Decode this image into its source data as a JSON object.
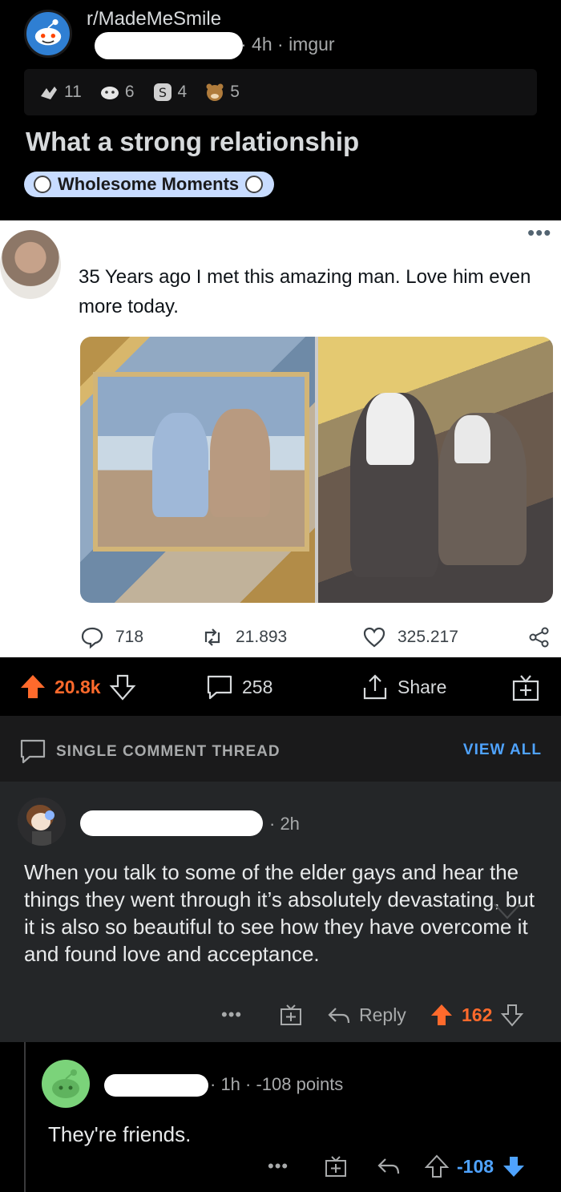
{
  "post": {
    "subreddit": "r/MadeMeSmile",
    "meta": "· 4h · imgur",
    "awards": [
      {
        "icon": "hug-award-icon",
        "count": "11"
      },
      {
        "icon": "wholesome-award-icon",
        "count": "6"
      },
      {
        "icon": "silver-award-icon",
        "count": "4"
      },
      {
        "icon": "bear-award-icon",
        "count": "5"
      }
    ],
    "title": "What a strong relationship",
    "flair": "Wholesome Moments"
  },
  "tweet": {
    "text": "35 Years ago I met this amazing man. Love him even more today.",
    "replies": "718",
    "retweets": "21.893",
    "likes": "325.217"
  },
  "post_actions": {
    "score": "20.8k",
    "comments": "258",
    "share": "Share"
  },
  "thread": {
    "label": "SINGLE COMMENT THREAD",
    "view_all": "VIEW ALL"
  },
  "comment1": {
    "meta": "· 2h",
    "text": "When you talk to some of the elder gays and hear the things they went through it’s absolutely devastating, but it is also so beautiful to see how they have overcome it and found love and acceptance.",
    "reply": "Reply",
    "score": "162"
  },
  "comment2": {
    "meta": "· 1h · -108 points",
    "text": "They're friends.",
    "score": "-108"
  },
  "colors": {
    "upvote": "#ff6a2c",
    "downvote": "#4fa3ff",
    "flair_bg": "#c8dcff"
  }
}
